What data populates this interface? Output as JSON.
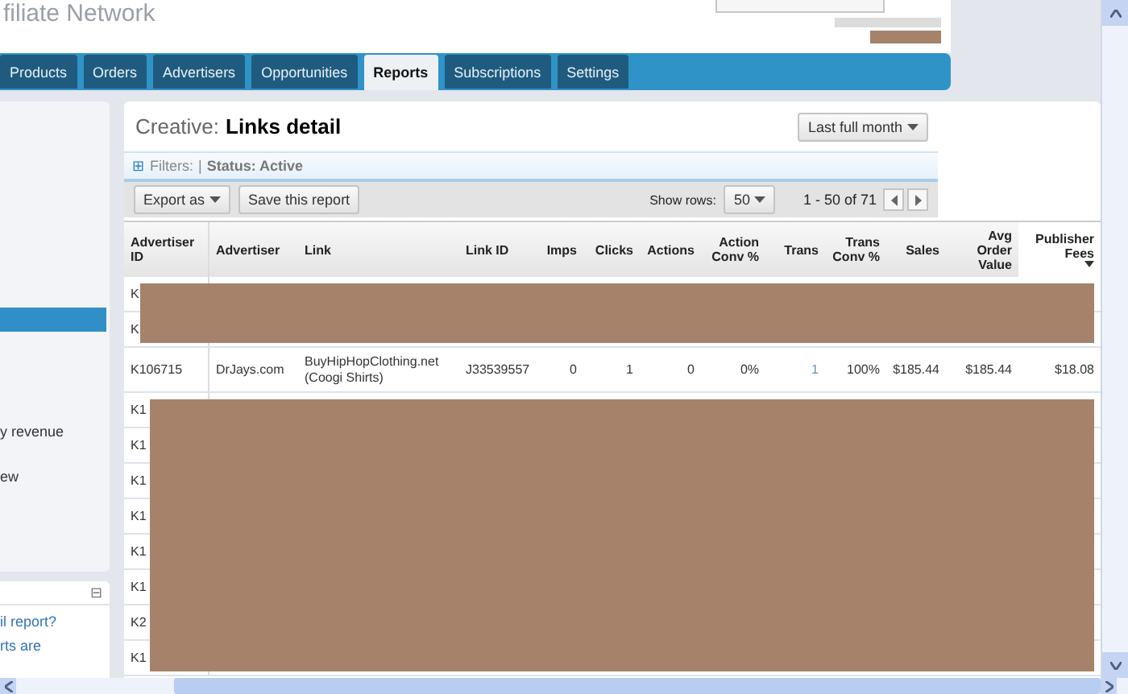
{
  "header": {
    "logo_text": "filiate Network"
  },
  "tabs": [
    {
      "label": "Products",
      "selected": false
    },
    {
      "label": "Orders",
      "selected": false
    },
    {
      "label": "Advertisers",
      "selected": false
    },
    {
      "label": "Opportunities",
      "selected": false
    },
    {
      "label": "Reports",
      "selected": true
    },
    {
      "label": "Subscriptions",
      "selected": false
    },
    {
      "label": "Settings",
      "selected": false
    }
  ],
  "sidebar": {
    "items": [
      {
        "selected": true
      },
      {
        "label": "y revenue",
        "selected": false
      },
      {
        "label": "ew",
        "selected": false
      }
    ],
    "help_panel": {
      "collapse_icon": "⊟",
      "link": "il report?",
      "text": "rts are"
    }
  },
  "report": {
    "title_prefix": "Creative:",
    "title": "Links detail",
    "period": "Last full month",
    "filters_icon": "⊞",
    "filters_label": "Filters:",
    "filter_separator": "|",
    "filter": "Status: Active",
    "export": "Export as",
    "save": "Save this report",
    "show_rows_label": "Show rows:",
    "show_rows": "50",
    "range": "1 - 50 of 71",
    "columns": [
      {
        "label": "Advertiser ID",
        "sorted": false
      },
      {
        "label": "Advertiser",
        "sorted": false
      },
      {
        "label": "Link",
        "sorted": false
      },
      {
        "label": "Link ID",
        "sorted": false
      },
      {
        "label": "Imps",
        "sorted": false
      },
      {
        "label": "Clicks",
        "sorted": false
      },
      {
        "label": "Actions",
        "sorted": false
      },
      {
        "label": "Action Conv %",
        "sorted": false
      },
      {
        "label": "Trans",
        "sorted": false
      },
      {
        "label": "Trans Conv %",
        "sorted": false
      },
      {
        "label": "Sales",
        "sorted": false
      },
      {
        "label": "Avg Order Value",
        "sorted": false
      },
      {
        "label": "Publisher Fees",
        "sorted": true
      }
    ],
    "rows": [
      {
        "redacted": true,
        "cells": [
          "K"
        ]
      },
      {
        "redacted": true,
        "cells": [
          "K"
        ]
      },
      {
        "redacted": false,
        "cells": [
          "K106715",
          "DrJays.com",
          "BuyHipHopClothing.net (Coogi Shirts)",
          "J33539557",
          "0",
          "1",
          "0",
          "0%",
          "1",
          "100%",
          "$185.44",
          "$185.44",
          "$18.08"
        ]
      },
      {
        "redacted": true,
        "cells": [
          "K1"
        ]
      },
      {
        "redacted": true,
        "cells": [
          "K1"
        ]
      },
      {
        "redacted": true,
        "cells": [
          "K1"
        ]
      },
      {
        "redacted": true,
        "cells": [
          "K1"
        ]
      },
      {
        "redacted": true,
        "cells": [
          "K1"
        ]
      },
      {
        "redacted": true,
        "cells": [
          "K1"
        ]
      },
      {
        "redacted": true,
        "cells": [
          "K2"
        ]
      },
      {
        "redacted": true,
        "cells": [
          "K1"
        ]
      }
    ]
  }
}
